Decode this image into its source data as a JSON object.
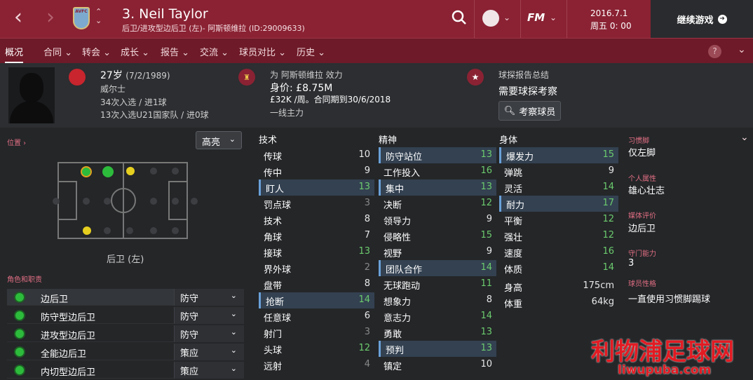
{
  "header": {
    "title": "3. Neil Taylor",
    "subtitle": "后卫/进攻型边后卫 (左)- 阿斯顿维拉 (ID:29009633)",
    "crest_text": "AVFC",
    "date": "2016.7.1",
    "weekday_time": "周五 0: 00",
    "continue_label": "继续游戏",
    "fm_label": "FM"
  },
  "menu": [
    {
      "label": "概况",
      "active": true
    },
    {
      "label": "合同"
    },
    {
      "label": "转会"
    },
    {
      "label": "成长"
    },
    {
      "label": "报告"
    },
    {
      "label": "交流"
    },
    {
      "label": "球员对比"
    },
    {
      "label": "历史"
    }
  ],
  "profile": {
    "age": "27岁",
    "dob": "(7/2/1989)",
    "nation": "威尔士",
    "caps": "34次入选 / 进1球",
    "u21_caps": "13次入选U21国家队 / 进0球",
    "club_line": "为 阿斯顿维拉 效力",
    "value": "身价: £8.75M",
    "wage": "£32K /周。合同期到30/6/2018",
    "status": "一线主力",
    "scout_title": "球探报告总结",
    "scout_needed": "需要球探考察",
    "scout_button": "考察球员"
  },
  "position": {
    "label": "位置",
    "highlight_select": "高亮",
    "position_name": "后卫 (左)"
  },
  "roles": {
    "label": "角色和职责",
    "items": [
      {
        "name": "边后卫",
        "duty": "防守"
      },
      {
        "name": "防守型边后卫",
        "duty": "防守"
      },
      {
        "name": "进攻型边后卫",
        "duty": "防守"
      },
      {
        "name": "全能边后卫",
        "duty": "策应"
      },
      {
        "name": "内切型边后卫",
        "duty": "策应"
      }
    ]
  },
  "technical": {
    "heading": "技术",
    "items": [
      {
        "name": "传球",
        "value": "10"
      },
      {
        "name": "传中",
        "value": "9"
      },
      {
        "name": "盯人",
        "value": "13",
        "hl": true
      },
      {
        "name": "罚点球",
        "value": "3"
      },
      {
        "name": "技术",
        "value": "8"
      },
      {
        "name": "角球",
        "value": "7"
      },
      {
        "name": "接球",
        "value": "13"
      },
      {
        "name": "界外球",
        "value": "2"
      },
      {
        "name": "盘带",
        "value": "8"
      },
      {
        "name": "抢断",
        "value": "14",
        "hl": true
      },
      {
        "name": "任意球",
        "value": "6"
      },
      {
        "name": "射门",
        "value": "3"
      },
      {
        "name": "头球",
        "value": "12"
      },
      {
        "name": "远射",
        "value": "4"
      }
    ]
  },
  "mental": {
    "heading": "精神",
    "items": [
      {
        "name": "防守站位",
        "value": "13",
        "hl": true
      },
      {
        "name": "工作投入",
        "value": "16"
      },
      {
        "name": "集中",
        "value": "13",
        "hl": true
      },
      {
        "name": "决断",
        "value": "12"
      },
      {
        "name": "领导力",
        "value": "9"
      },
      {
        "name": "侵略性",
        "value": "15"
      },
      {
        "name": "视野",
        "value": "9"
      },
      {
        "name": "团队合作",
        "value": "14",
        "hl": true
      },
      {
        "name": "无球跑动",
        "value": "11"
      },
      {
        "name": "想象力",
        "value": "8"
      },
      {
        "name": "意志力",
        "value": "14"
      },
      {
        "name": "勇敢",
        "value": "13"
      },
      {
        "name": "预判",
        "value": "13",
        "hl": true
      },
      {
        "name": "镇定",
        "value": "10"
      }
    ]
  },
  "physical": {
    "heading": "身体",
    "items": [
      {
        "name": "爆发力",
        "value": "15",
        "hl": true
      },
      {
        "name": "弹跳",
        "value": "9"
      },
      {
        "name": "灵活",
        "value": "14"
      },
      {
        "name": "耐力",
        "value": "17",
        "hl": true
      },
      {
        "name": "平衡",
        "value": "12"
      },
      {
        "name": "强壮",
        "value": "12"
      },
      {
        "name": "速度",
        "value": "16"
      },
      {
        "name": "体质",
        "value": "14"
      }
    ],
    "height_label": "身高",
    "height": "175cm",
    "weight_label": "体重",
    "weight": "64kg"
  },
  "side": {
    "foot_label": "习惯脚",
    "foot": "仅左脚",
    "personality_label": "个人属性",
    "personality": "雄心壮志",
    "media_label": "媒体评价",
    "media": "边后卫",
    "gk_label": "守门能力",
    "gk": "3",
    "traits_label": "球员性格",
    "traits": "一直使用习惯脚踢球"
  },
  "watermark": {
    "line1": "利物浦足球网",
    "line2": "liwupuba.com"
  },
  "colors": {
    "header_red": "#8a2233",
    "menu_red": "#6e1a28",
    "highlight_blue": "#334151",
    "value_green": "#6ccb6e"
  }
}
